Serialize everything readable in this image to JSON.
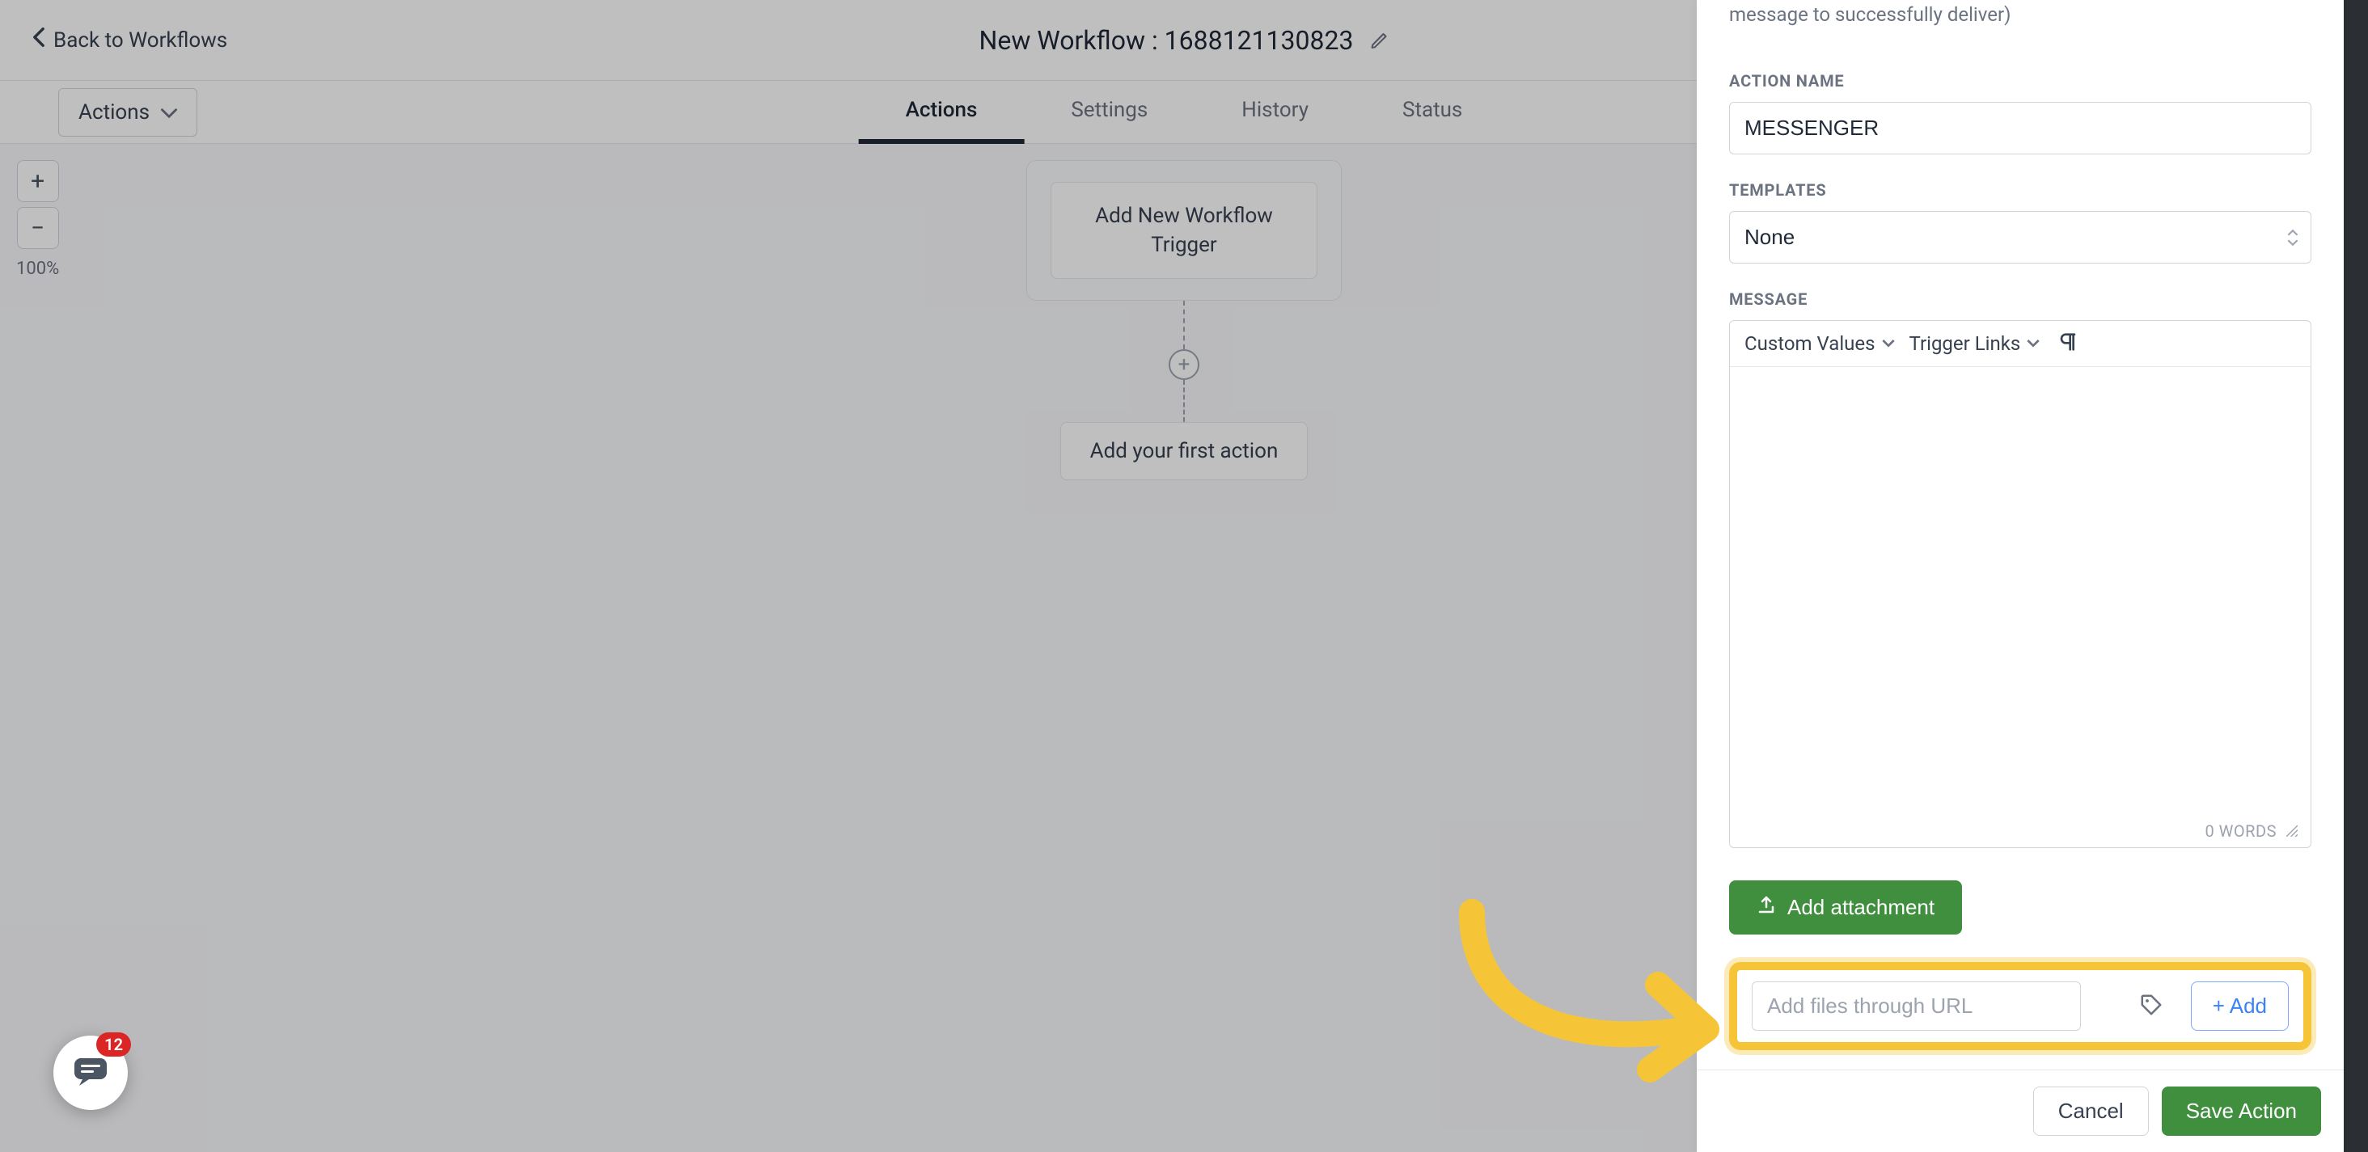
{
  "header": {
    "back_label": "Back to Workflows",
    "title": "New Workflow : 1688121130823"
  },
  "toolbar": {
    "actions_label": "Actions"
  },
  "tabs": {
    "actions": "Actions",
    "settings": "Settings",
    "history": "History",
    "status": "Status"
  },
  "canvas": {
    "zoom_level": "100%",
    "trigger_card": "Add New Workflow Trigger",
    "first_action": "Add your first action"
  },
  "panel": {
    "head_note": "message to successfully deliver)",
    "action_name_label": "ACTION NAME",
    "action_name_value": "MESSENGER",
    "templates_label": "TEMPLATES",
    "templates_value": "None",
    "message_label": "MESSAGE",
    "custom_values": "Custom Values",
    "trigger_links": "Trigger Links",
    "word_count": "0 WORDS",
    "add_attachment": "Add attachment",
    "url_placeholder": "Add files through URL",
    "add_url_button": "+ Add",
    "cancel": "Cancel",
    "save": "Save Action"
  },
  "chat": {
    "badge": "12"
  }
}
